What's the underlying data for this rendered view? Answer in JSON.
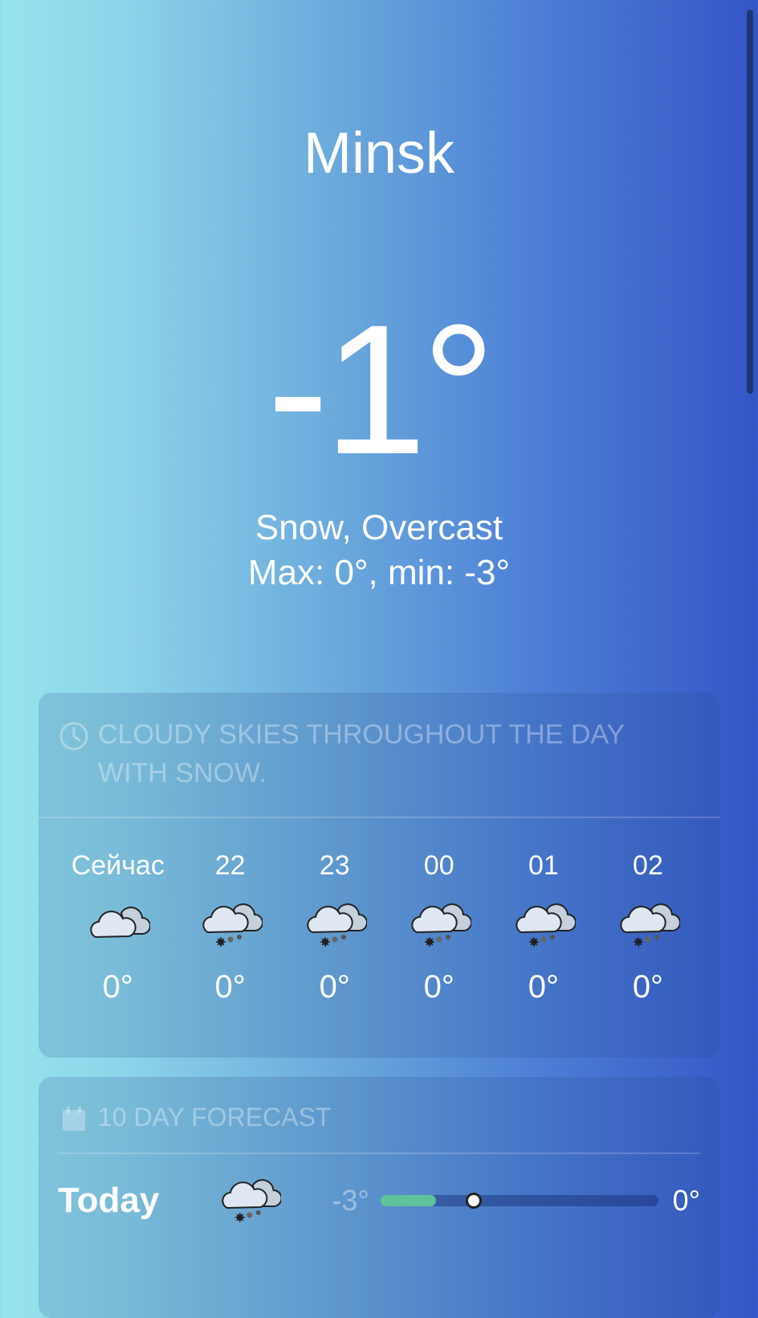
{
  "current": {
    "city": "Minsk",
    "temperature": "-1°",
    "condition": "Snow, Overcast",
    "max_min": "Max: 0°, min: -3°"
  },
  "hourly_card": {
    "icon": "clock-icon",
    "summary": "CLOUDY SKIES THROUGHOUT THE DAY WITH SNOW.",
    "hours": [
      {
        "label": "Сейчас",
        "icon": "cloudy-icon",
        "temp": "0°"
      },
      {
        "label": "22",
        "icon": "snow-cloud-icon",
        "temp": "0°"
      },
      {
        "label": "23",
        "icon": "snow-cloud-icon",
        "temp": "0°"
      },
      {
        "label": "00",
        "icon": "snow-cloud-icon",
        "temp": "0°"
      },
      {
        "label": "01",
        "icon": "snow-cloud-icon",
        "temp": "0°"
      },
      {
        "label": "02",
        "icon": "snow-cloud-icon",
        "temp": "0°"
      }
    ]
  },
  "daily_card": {
    "icon": "calendar-icon",
    "title": "10 DAY FORECAST",
    "days": [
      {
        "name": "Today",
        "icon": "snow-cloud-icon",
        "low": "-3°",
        "high": "0°",
        "bar_fill": 0.2,
        "current_position": 0.33
      }
    ]
  },
  "colors": {
    "bar_fill": "#5ec29b",
    "gradient_left": "#96e4ee",
    "gradient_right": "#3456c6"
  }
}
